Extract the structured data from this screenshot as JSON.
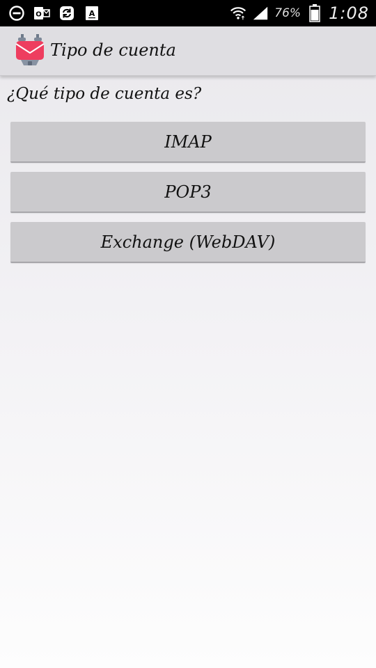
{
  "status_bar": {
    "battery": "76%",
    "time": "1:08",
    "left_icons": [
      "do-not-disturb-icon",
      "outlook-icon",
      "sync-icon",
      "font-icon"
    ],
    "right_icons": [
      "wifi-icon",
      "signal-icon",
      "battery-icon"
    ]
  },
  "action_bar": {
    "title": "Tipo de cuenta",
    "app_icon": "k9-mail-icon",
    "accent_color": "#ee3d5f"
  },
  "prompt": "¿Qué tipo de cuenta es?",
  "options": [
    {
      "label": "IMAP"
    },
    {
      "label": "POP3"
    },
    {
      "label": "Exchange (WebDAV)"
    }
  ]
}
